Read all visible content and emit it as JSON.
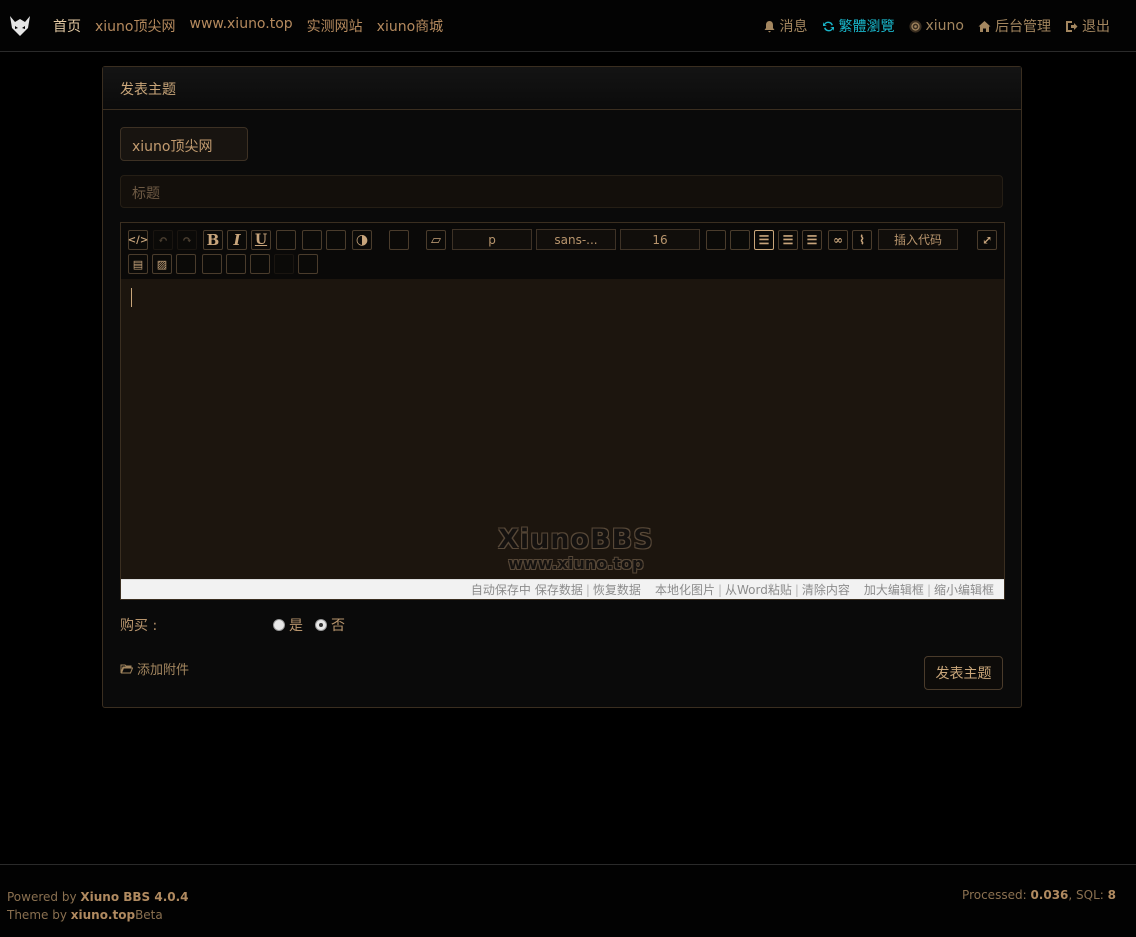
{
  "header": {
    "nav_left": [
      "首页",
      "xiuno顶尖网",
      "www.xiuno.top",
      "实测网站",
      "xiuno商城"
    ],
    "nav_right": {
      "messages": "消息",
      "traditional": "繁體瀏覽",
      "username": "xiuno",
      "admin": "后台管理",
      "logout": "退出"
    }
  },
  "card": {
    "title": "发表主题",
    "forum_select": "xiuno顶尖网",
    "title_placeholder": "标题"
  },
  "editor": {
    "block_format": "p",
    "font_family": "sans-...",
    "font_size": "16",
    "insert_code": "插入代码",
    "watermark_line1": "XiunoBBS",
    "watermark_line2": "www.xiuno.top",
    "status": {
      "autosave": "自动保存中",
      "save": "保存数据",
      "restore": "恢复数据",
      "localize_images": "本地化图片",
      "paste_word": "从Word粘贴",
      "clear": "清除内容",
      "enlarge": "加大编辑框",
      "shrink": "缩小编辑框"
    }
  },
  "purchase": {
    "label": "购买 :",
    "yes": "是",
    "no": "否",
    "selected": "否"
  },
  "attach_label": "添加附件",
  "submit_label": "发表主题",
  "footer": {
    "powered_prefix": "Powered by ",
    "powered_name": "Xiuno BBS 4.0.4",
    "theme_prefix": "Theme by ",
    "theme_name": "xiuno.top",
    "theme_suffix": "Beta",
    "processed_prefix": "Processed: ",
    "processed_time": "0.036",
    "sql_prefix": ", SQL: ",
    "sql_count": "8"
  },
  "colors": {
    "accent": "#c9a67a",
    "cyan": "#19b5c9",
    "background": "#000000"
  },
  "icons": [
    "logo-icon",
    "bell-icon",
    "refresh-icon",
    "avatar-icon",
    "home-icon",
    "logout-icon",
    "folder-open-icon"
  ]
}
